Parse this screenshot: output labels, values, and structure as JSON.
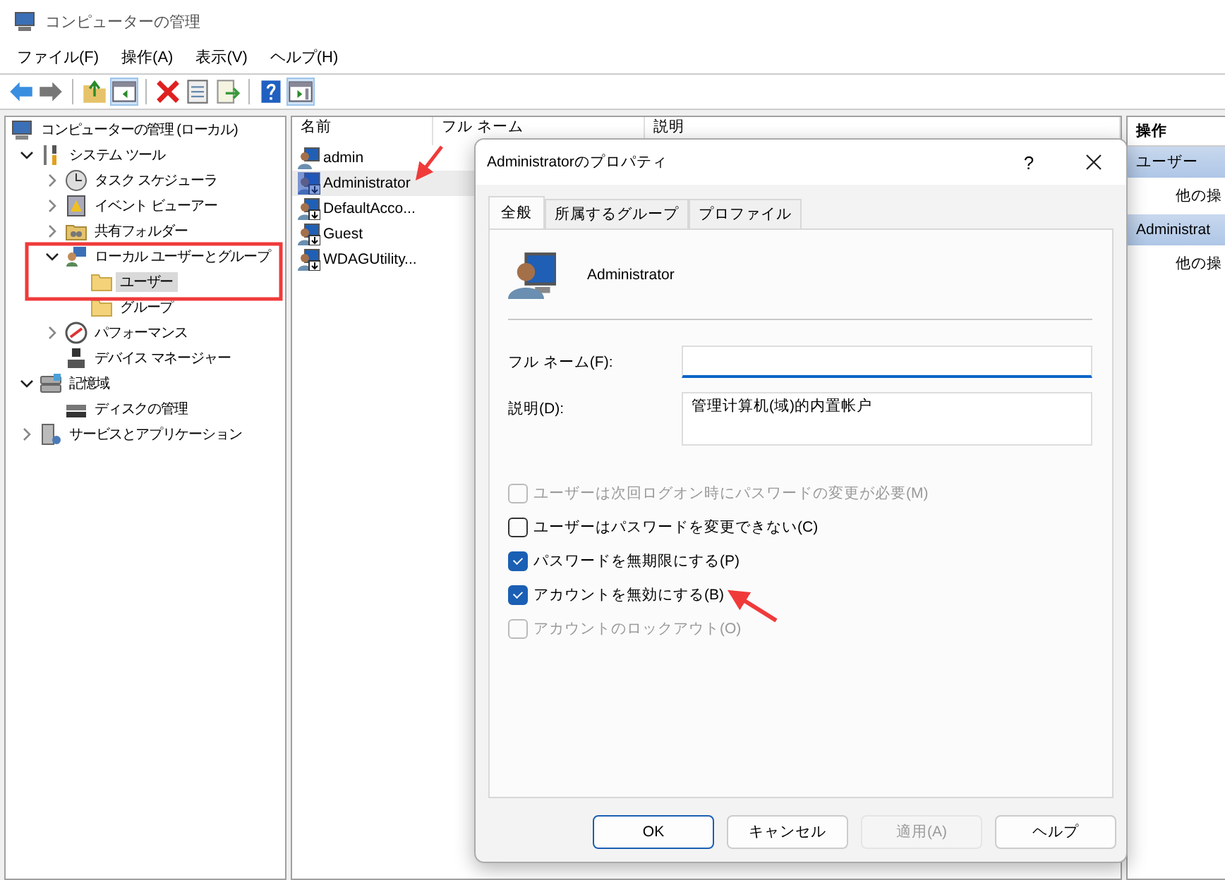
{
  "window": {
    "title": "コンピューターの管理"
  },
  "menu": [
    {
      "label": "ファイル(F)"
    },
    {
      "label": "操作(A)"
    },
    {
      "label": "表示(V)"
    },
    {
      "label": "ヘルプ(H)"
    }
  ],
  "tree": [
    {
      "label": "コンピューターの管理 (ローカル)",
      "kind": "computer",
      "selected": false,
      "children": [
        {
          "label": "システム ツール",
          "kind": "tools",
          "expanded": true,
          "selected": false,
          "children": [
            {
              "label": "タスク スケジューラ",
              "kind": "clock",
              "expanded": false,
              "selected": false
            },
            {
              "label": "イベント ビューアー",
              "kind": "log",
              "expanded": false,
              "selected": false
            },
            {
              "label": "共有フォルダー",
              "kind": "share",
              "expanded": false,
              "selected": false
            },
            {
              "label": "ローカル ユーザーとグループ",
              "kind": "users",
              "expanded": true,
              "selected": false,
              "children": [
                {
                  "label": "ユーザー",
                  "kind": "folder",
                  "selected": true
                },
                {
                  "label": "グループ",
                  "kind": "folder",
                  "selected": false
                }
              ]
            },
            {
              "label": "パフォーマンス",
              "kind": "perf",
              "expanded": false,
              "selected": false
            },
            {
              "label": "デバイス マネージャー",
              "kind": "device",
              "selected": false
            }
          ]
        },
        {
          "label": "記憶域",
          "kind": "storage",
          "expanded": true,
          "selected": false,
          "children": [
            {
              "label": "ディスクの管理",
              "kind": "disk",
              "selected": false
            }
          ]
        },
        {
          "label": "サービスとアプリケーション",
          "kind": "services",
          "expanded": false,
          "selected": false
        }
      ]
    }
  ],
  "list": {
    "columns": [
      "名前",
      "フル ネーム",
      "説明"
    ],
    "rows": [
      {
        "name": "admin",
        "kind": "user",
        "selected": false
      },
      {
        "name": "Administrator",
        "kind": "disabled-user",
        "selected": true
      },
      {
        "name": "DefaultAcco...",
        "kind": "disabled-user",
        "selected": false
      },
      {
        "name": "Guest",
        "kind": "disabled-user",
        "selected": false
      },
      {
        "name": "WDAGUtility...",
        "kind": "disabled-user",
        "selected": false
      }
    ]
  },
  "actions": {
    "header": "操作",
    "sections": [
      {
        "title": "ユーザー",
        "item": "他の操"
      },
      {
        "title": "Administrat",
        "item": "他の操"
      }
    ]
  },
  "dialog": {
    "title": "Administratorのプロパティ",
    "help_button": "?",
    "tabs": [
      {
        "label": "全般",
        "selected": true
      },
      {
        "label": "所属するグループ",
        "selected": false
      },
      {
        "label": "プロファイル",
        "selected": false
      }
    ],
    "user_name": "Administrator",
    "fields": [
      {
        "label": "フル ネーム(F):",
        "focused": true,
        "multiline": false
      },
      {
        "label": "説明(D):",
        "value": "管理计算机(域)的内置帐户",
        "focused": false,
        "multiline": true
      }
    ],
    "checkboxes": [
      {
        "label": "ユーザーは次回ログオン時にパスワードの変更が必要(M)",
        "checked": false,
        "disabled": true
      },
      {
        "label": "ユーザーはパスワードを変更できない(C)",
        "checked": false,
        "disabled": false
      },
      {
        "label": "パスワードを無期限にする(P)",
        "checked": true,
        "disabled": false
      },
      {
        "label": "アカウントを無効にする(B)",
        "checked": true,
        "disabled": false
      },
      {
        "label": "アカウントのロックアウト(O)",
        "checked": false,
        "disabled": true
      }
    ],
    "buttons": [
      {
        "label": "OK",
        "default": true,
        "disabled": false
      },
      {
        "label": "キャンセル",
        "default": false,
        "disabled": false
      },
      {
        "label": "適用(A)",
        "default": false,
        "disabled": true
      },
      {
        "label": "ヘルプ",
        "default": false,
        "disabled": false
      }
    ]
  }
}
